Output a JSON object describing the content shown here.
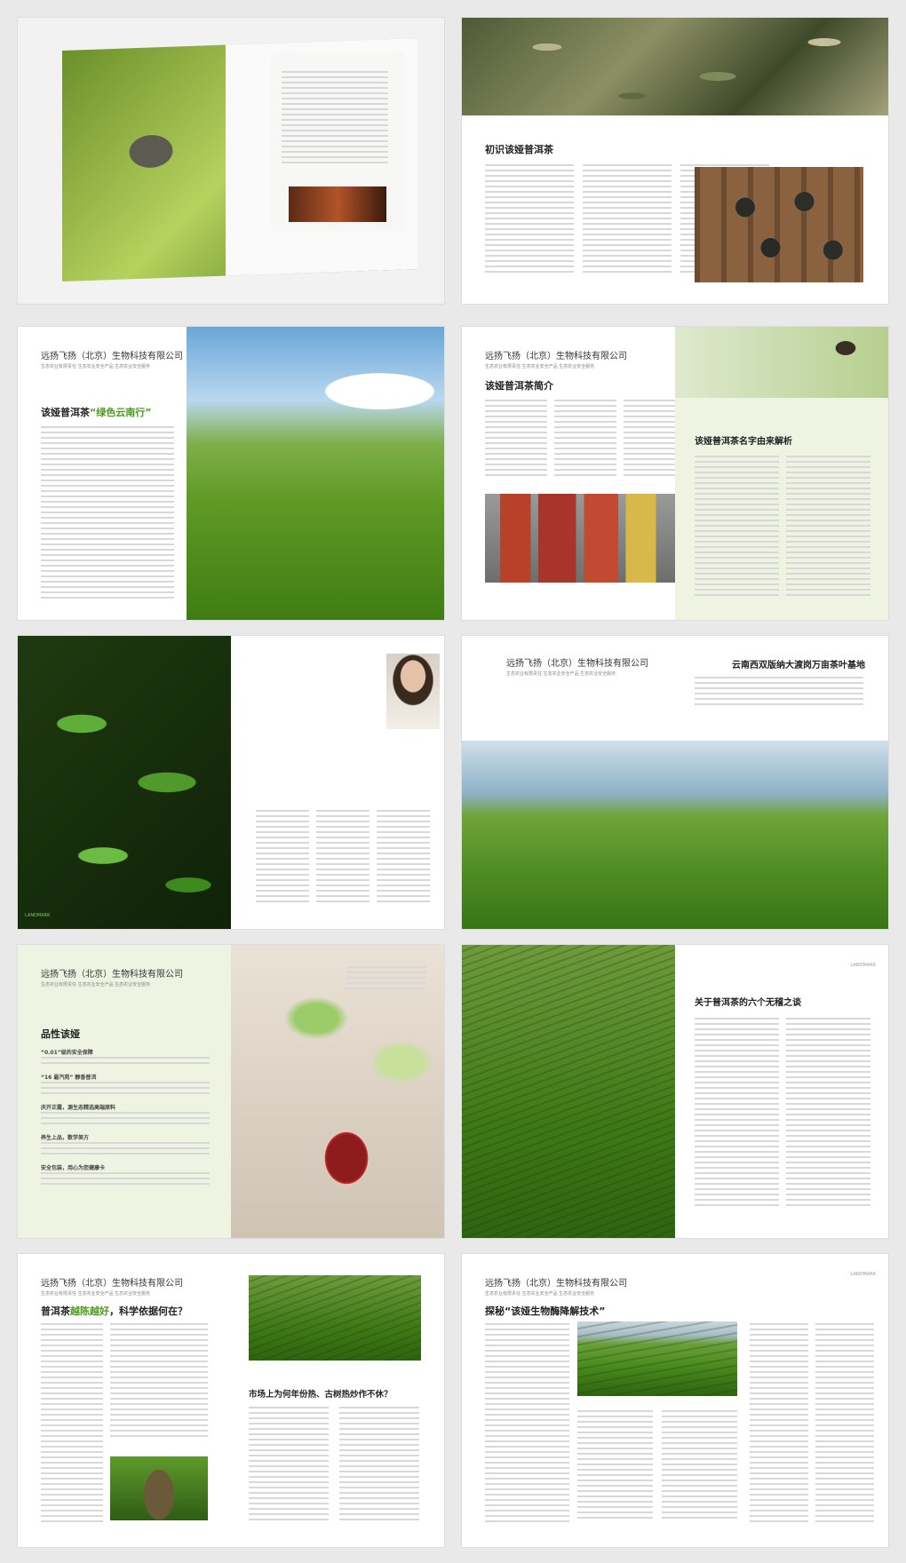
{
  "company": {
    "name": "远扬飞扬（北京）生物科技有限公司",
    "tagline": "生态农业有限责任  生态农业安全产品  生态农业安全服务"
  },
  "spreads": [
    {
      "left": {
        "photo": "magazine-cover-teapot"
      },
      "right": {
        "title": "初识该娅普洱茶"
      }
    },
    {
      "left": {
        "title_prefix": "该娅普洱茶",
        "title_highlight": "“绿色云南行”"
      },
      "right": {
        "photo": "tea-plantation-hills"
      }
    },
    {
      "left": {
        "title": "该娅普洱茶简介",
        "photo": "red-tea-gift-boxes"
      },
      "right": {
        "title": "该娅普洱茶名字由来解析"
      }
    },
    {
      "left": {
        "photo": "green-leaves",
        "mark": "LANDMARK"
      },
      "right": {
        "photo": "founder-portrait"
      }
    },
    {
      "left": {
        "photo": "terraced-hills"
      },
      "right": {
        "title": "云南西双版纳大渡岗万亩茶叶基地"
      }
    },
    {
      "left": {
        "title": "品性该娅",
        "sections": [
          {
            "heading": "“0.01”级的安全保障"
          },
          {
            "heading": "“16 最汽苑”  醇香普洱"
          },
          {
            "heading": "庆开正露，源生态精选高端原料"
          },
          {
            "heading": "养生上品，数学美方"
          },
          {
            "heading": "安全包装，用心为您健康卡"
          }
        ]
      },
      "right": {
        "photo": "red-tea-cup"
      }
    },
    {
      "left": {
        "photo": "tea-terraces-closeup"
      },
      "right": {
        "title": "关于普洱茶的六个无稽之谈",
        "mark": "LANDMARK"
      }
    },
    {
      "left": {
        "title_prefix": "普洱茶",
        "title_highlight": "越陈越好",
        "title_suffix": "，科学依据何在？"
      },
      "right": {
        "title": "市场上为何年份热、古树热炒作不休？"
      }
    },
    {
      "left": {
        "title": "探秘“该娅生物酶降解技术”"
      },
      "right": {
        "mark": "LANDMARK"
      }
    }
  ]
}
